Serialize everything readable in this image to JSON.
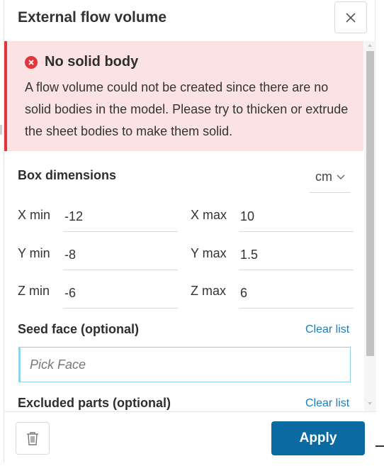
{
  "header": {
    "title": "External flow volume"
  },
  "alert": {
    "title": "No solid body",
    "message": "A flow volume could not be created since there are no solid bodies in the model. Please try to thicken or extrude the sheet bodies to make them solid.",
    "color": "#e0373e"
  },
  "box_dimensions": {
    "label": "Box dimensions",
    "unit": "cm",
    "fields": {
      "x_min": {
        "label": "X min",
        "value": "-12"
      },
      "x_max": {
        "label": "X max",
        "value": "10"
      },
      "y_min": {
        "label": "Y min",
        "value": "-8"
      },
      "y_max": {
        "label": "Y max",
        "value": "1.5"
      },
      "z_min": {
        "label": "Z min",
        "value": "-6"
      },
      "z_max": {
        "label": "Z max",
        "value": "6"
      }
    }
  },
  "seed_face": {
    "label": "Seed face (optional)",
    "clear_label": "Clear list",
    "placeholder": "Pick Face"
  },
  "excluded_parts": {
    "label": "Excluded parts (optional)",
    "clear_label": "Clear list"
  },
  "footer": {
    "apply_label": "Apply",
    "accent": "#0a6aa1"
  },
  "icons": [
    "close-icon",
    "error-icon",
    "chevron-down-icon",
    "trash-icon"
  ]
}
